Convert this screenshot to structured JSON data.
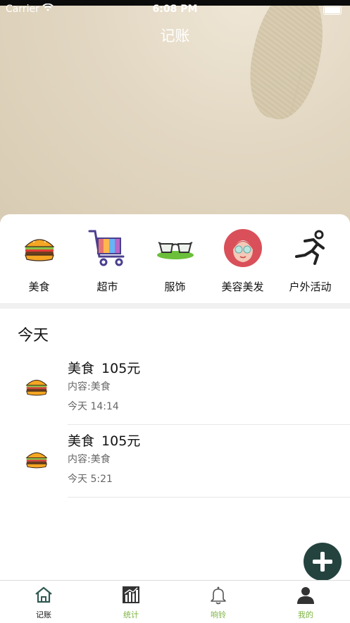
{
  "status": {
    "carrier": "Carrier",
    "time": "6:08 PM"
  },
  "header": {
    "title": "记账"
  },
  "categories": [
    {
      "label": "美食",
      "icon": "burger-icon"
    },
    {
      "label": "超市",
      "icon": "shopping-cart-icon"
    },
    {
      "label": "服饰",
      "icon": "glasses-icon"
    },
    {
      "label": "美容美发",
      "icon": "face-mask-icon"
    },
    {
      "label": "户外活动",
      "icon": "running-icon"
    }
  ],
  "section_title": "今天",
  "records": [
    {
      "category": "美食",
      "amount": "105元",
      "content": "内容:美食",
      "time": "今天 14:14",
      "icon": "burger-icon"
    },
    {
      "category": "美食",
      "amount": "105元",
      "content": "内容:美食",
      "time": "今天 5:21",
      "icon": "burger-icon"
    }
  ],
  "fab": {
    "icon": "plus-icon"
  },
  "tabs": [
    {
      "label": "记账",
      "icon": "home-icon",
      "active": true
    },
    {
      "label": "统计",
      "icon": "chart-icon",
      "active": false
    },
    {
      "label": "响铃",
      "icon": "bell-icon",
      "active": false
    },
    {
      "label": "我的",
      "icon": "user-icon",
      "active": false
    }
  ],
  "colors": {
    "tab_active": "#111111",
    "tab_inactive": "#7cb342",
    "fab": "#24433f"
  }
}
